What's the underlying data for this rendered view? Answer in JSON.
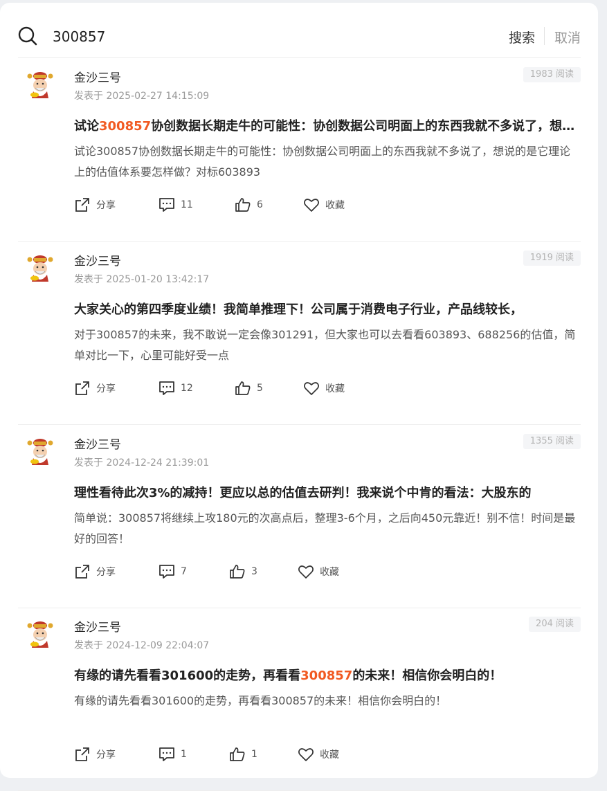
{
  "search": {
    "query": "300857",
    "search_label": "搜索",
    "cancel_label": "取消"
  },
  "actions": {
    "share": "分享",
    "favorite": "收藏"
  },
  "colors": {
    "highlight": "#f15a22"
  },
  "posts": [
    {
      "author": "金沙三号",
      "date": "发表于 2025-02-27 14:15:09",
      "reads": "1983 阅读",
      "title_pre": "试论",
      "title_hl": "300857",
      "title_post": "协创数据长期走牛的可能性：协创数据公司明面上的东西我就不多说了，想说的是它理论上的估值体系要怎样做？对标603893",
      "body": "试论300857协创数据长期走牛的可能性：协创数据公司明面上的东西我就不多说了，想说的是它理论上的估值体系要怎样做？对标603893",
      "comments": "11",
      "likes": "6"
    },
    {
      "author": "金沙三号",
      "date": "发表于 2025-01-20 13:42:17",
      "reads": "1919 阅读",
      "title_pre": "大家关心的第四季度业绩！我简单推理下！公司属于消费电子行业，产品线较长，",
      "title_hl": "",
      "title_post": "",
      "body": "对于300857的未来，我不敢说一定会像301291，但大家也可以去看看603893、688256的估值，简单对比一下，心里可能好受一点",
      "comments": "12",
      "likes": "5"
    },
    {
      "author": "金沙三号",
      "date": "发表于 2024-12-24 21:39:01",
      "reads": "1355 阅读",
      "title_pre": "理性看待此次3%的减持！更应以总的估值去研判！我来说个中肯的看法：大股东的",
      "title_hl": "",
      "title_post": "",
      "body": "简单说：300857将继续上攻180元的次高点后，整理3-6个月，之后向450元靠近！别不信！时间是最好的回答！",
      "comments": "7",
      "likes": "3"
    },
    {
      "author": "金沙三号",
      "date": "发表于 2024-12-09 22:04:07",
      "reads": "204 阅读",
      "title_pre": "有缘的请先看看301600的走势，再看看",
      "title_hl": "300857",
      "title_post": "的未来！相信你会明白的！",
      "body": "有缘的请先看看301600的走势，再看看300857的未来！相信你会明白的！",
      "comments": "1",
      "likes": "1"
    }
  ]
}
